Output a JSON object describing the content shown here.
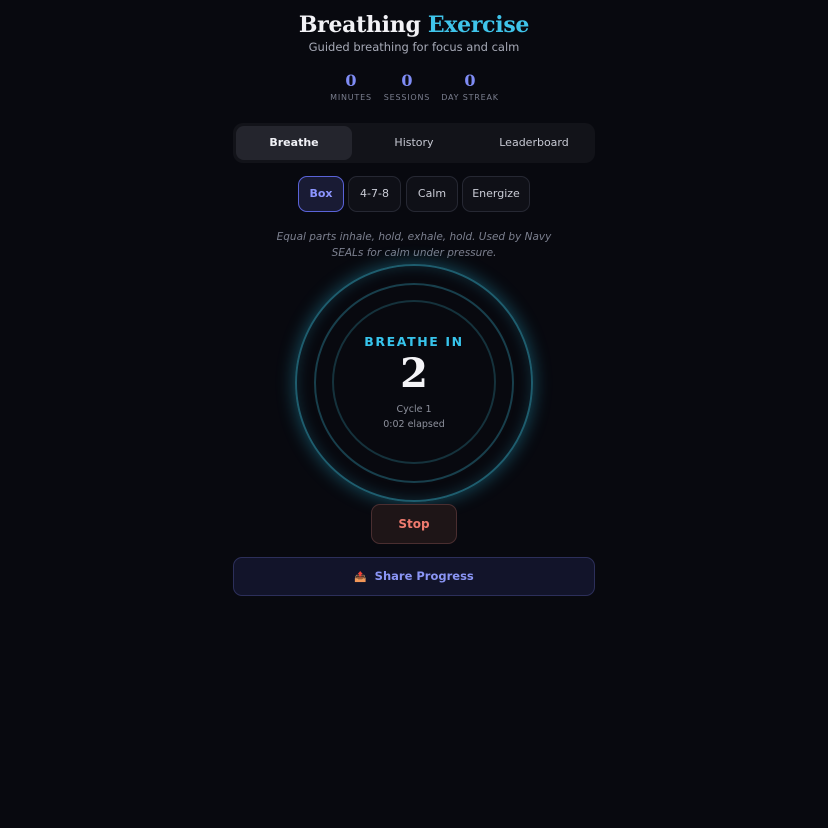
{
  "header": {
    "title_word1": "Breathing",
    "title_word2": "Exercise",
    "subtitle": "Guided breathing for focus and calm"
  },
  "stats": [
    {
      "value": "0",
      "label": "MINUTES"
    },
    {
      "value": "0",
      "label": "SESSIONS"
    },
    {
      "value": "0",
      "label": "DAY STREAK"
    }
  ],
  "tabs": [
    {
      "label": "Breathe",
      "active": true
    },
    {
      "label": "History",
      "active": false
    },
    {
      "label": "Leaderboard",
      "active": false
    }
  ],
  "patterns": [
    {
      "label": "Box",
      "active": true
    },
    {
      "label": "4-7-8",
      "active": false
    },
    {
      "label": "Calm",
      "active": false
    },
    {
      "label": "Energize",
      "active": false
    }
  ],
  "description": "Equal parts inhale, hold, exhale, hold. Used by Navy SEALs for calm under pressure.",
  "session": {
    "phase": "BREATHE IN",
    "countdown": "2",
    "cycle": "Cycle 1",
    "elapsed": "0:02 elapsed"
  },
  "buttons": {
    "stop": "Stop",
    "share_icon": "📤",
    "share": "Share Progress"
  },
  "colors": {
    "background": "#08090f",
    "accent_indigo": "#8a95f5",
    "accent_cyan": "#37c4ec",
    "stop_red": "#ee7a6e"
  }
}
